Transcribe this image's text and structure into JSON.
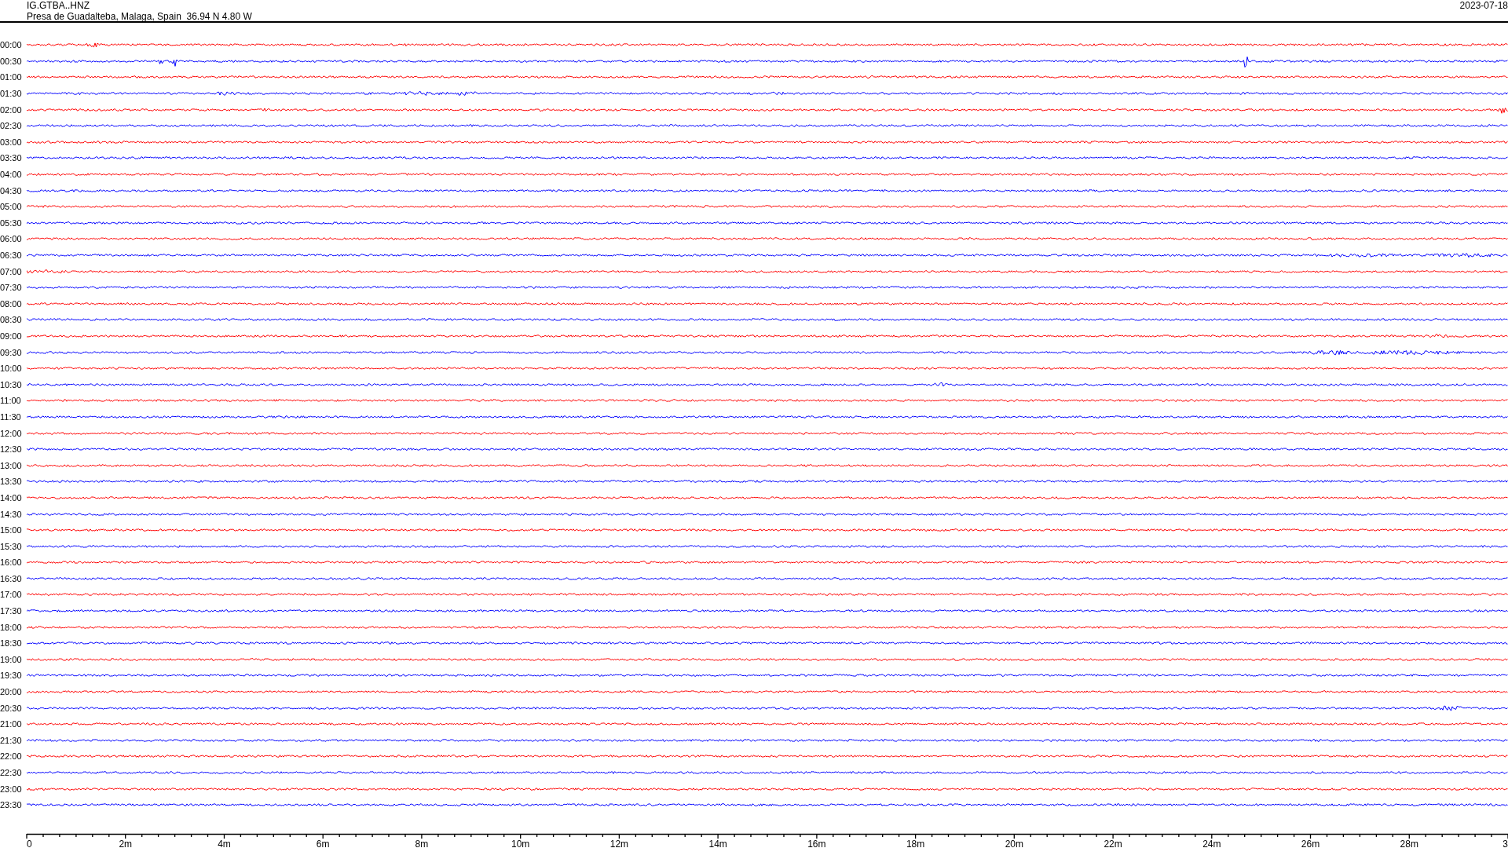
{
  "header": {
    "station": "IG.GTBA..HNZ",
    "location": "Presa de Guadalteba, Malaga, Spain  36.94 N 4.80 W",
    "date": "2023-07-18"
  },
  "traces": [
    {
      "label": "00:00",
      "color": "#ff0000"
    },
    {
      "label": "00:30",
      "color": "#0000ff"
    },
    {
      "label": "01:00",
      "color": "#ff0000"
    },
    {
      "label": "01:30",
      "color": "#0000ff"
    },
    {
      "label": "02:00",
      "color": "#ff0000"
    },
    {
      "label": "02:30",
      "color": "#0000ff"
    },
    {
      "label": "03:00",
      "color": "#ff0000"
    },
    {
      "label": "03:30",
      "color": "#0000ff"
    },
    {
      "label": "04:00",
      "color": "#ff0000"
    },
    {
      "label": "04:30",
      "color": "#0000ff"
    },
    {
      "label": "05:00",
      "color": "#ff0000"
    },
    {
      "label": "05:30",
      "color": "#0000ff"
    },
    {
      "label": "06:00",
      "color": "#ff0000"
    },
    {
      "label": "06:30",
      "color": "#0000ff"
    },
    {
      "label": "07:00",
      "color": "#ff0000"
    },
    {
      "label": "07:30",
      "color": "#0000ff"
    },
    {
      "label": "08:00",
      "color": "#ff0000"
    },
    {
      "label": "08:30",
      "color": "#0000ff"
    },
    {
      "label": "09:00",
      "color": "#ff0000"
    },
    {
      "label": "09:30",
      "color": "#0000ff"
    },
    {
      "label": "10:00",
      "color": "#ff0000"
    },
    {
      "label": "10:30",
      "color": "#0000ff"
    },
    {
      "label": "11:00",
      "color": "#ff0000"
    },
    {
      "label": "11:30",
      "color": "#0000ff"
    },
    {
      "label": "12:00",
      "color": "#ff0000"
    },
    {
      "label": "12:30",
      "color": "#0000ff"
    },
    {
      "label": "13:00",
      "color": "#ff0000"
    },
    {
      "label": "13:30",
      "color": "#0000ff"
    },
    {
      "label": "14:00",
      "color": "#ff0000"
    },
    {
      "label": "14:30",
      "color": "#0000ff"
    },
    {
      "label": "15:00",
      "color": "#ff0000"
    },
    {
      "label": "15:30",
      "color": "#0000ff"
    },
    {
      "label": "16:00",
      "color": "#ff0000"
    },
    {
      "label": "16:30",
      "color": "#0000ff"
    },
    {
      "label": "17:00",
      "color": "#ff0000"
    },
    {
      "label": "17:30",
      "color": "#0000ff"
    },
    {
      "label": "18:00",
      "color": "#ff0000"
    },
    {
      "label": "18:30",
      "color": "#0000ff"
    },
    {
      "label": "19:00",
      "color": "#ff0000"
    },
    {
      "label": "19:30",
      "color": "#0000ff"
    },
    {
      "label": "20:00",
      "color": "#ff0000"
    },
    {
      "label": "20:30",
      "color": "#0000ff"
    },
    {
      "label": "21:00",
      "color": "#ff0000"
    },
    {
      "label": "21:30",
      "color": "#0000ff"
    },
    {
      "label": "22:00",
      "color": "#ff0000"
    },
    {
      "label": "22:30",
      "color": "#0000ff"
    },
    {
      "label": "23:00",
      "color": "#ff0000"
    },
    {
      "label": "23:30",
      "color": "#0000ff"
    }
  ],
  "x_axis": {
    "tick_labels": [
      "0",
      "2m",
      "4m",
      "6m",
      "8m",
      "10m",
      "12m",
      "14m",
      "16m",
      "18m",
      "20m",
      "22m",
      "24m",
      "26m",
      "28m",
      "3"
    ]
  }
}
